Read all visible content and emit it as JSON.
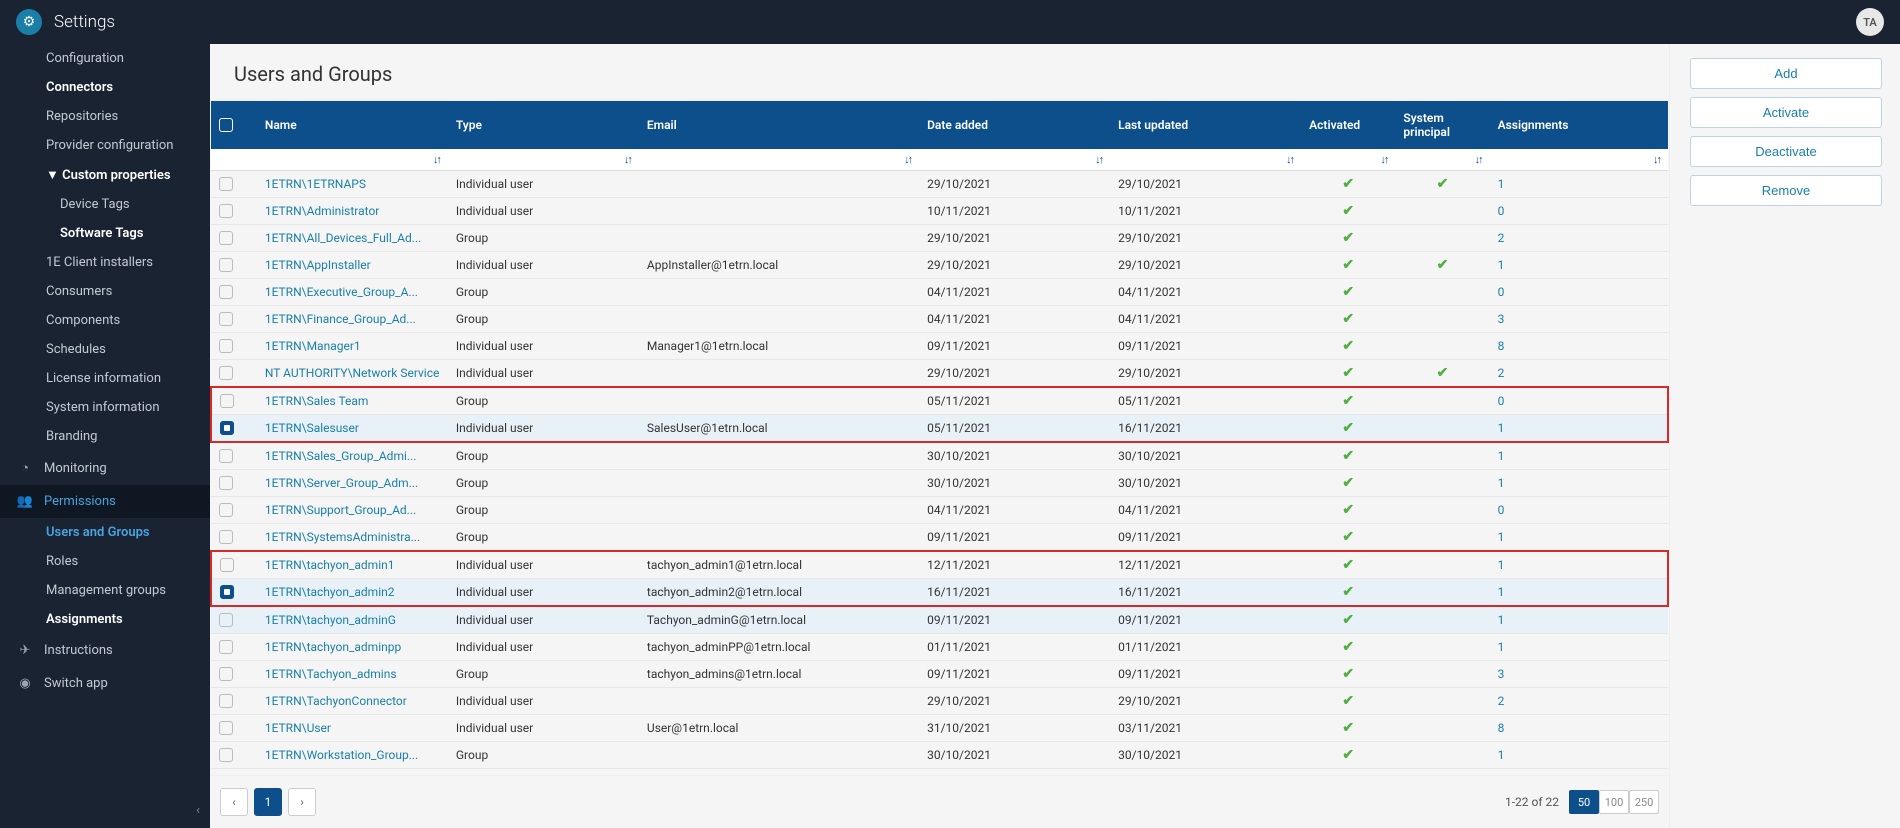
{
  "header": {
    "title": "Settings",
    "avatar": "TA"
  },
  "sidebar": {
    "top": [
      {
        "label": "Configuration",
        "kind": "dim"
      },
      {
        "label": "Connectors",
        "kind": "bold"
      },
      {
        "label": "Repositories",
        "kind": "item"
      },
      {
        "label": "Provider configuration",
        "kind": "item"
      },
      {
        "label": "Custom properties",
        "kind": "bold",
        "caret": true
      },
      {
        "label": "Device Tags",
        "kind": "l3dim"
      },
      {
        "label": "Software Tags",
        "kind": "l3"
      },
      {
        "label": "1E Client installers",
        "kind": "item"
      },
      {
        "label": "Consumers",
        "kind": "item"
      },
      {
        "label": "Components",
        "kind": "item"
      },
      {
        "label": "Schedules",
        "kind": "item"
      },
      {
        "label": "License information",
        "kind": "item"
      },
      {
        "label": "System information",
        "kind": "item"
      },
      {
        "label": "Branding",
        "kind": "item"
      }
    ],
    "sections": [
      {
        "icon": "◔",
        "label": "Monitoring",
        "active": false
      },
      {
        "icon": "👥",
        "label": "Permissions",
        "active": true
      }
    ],
    "perm_children": [
      {
        "label": "Users and Groups",
        "active": true
      },
      {
        "label": "Roles",
        "active": false
      },
      {
        "label": "Management groups",
        "active": false
      },
      {
        "label": "Assignments",
        "active": false,
        "bold": true
      }
    ],
    "bottom": [
      {
        "icon": "✈",
        "label": "Instructions"
      },
      {
        "icon": "◉",
        "label": "Switch app"
      }
    ]
  },
  "page": {
    "heading": "Users and Groups"
  },
  "columns": {
    "name": "Name",
    "type": "Type",
    "email": "Email",
    "date": "Date added",
    "updated": "Last updated",
    "activated": "Activated",
    "system": "System principal",
    "assignments": "Assignments"
  },
  "rows": [
    {
      "chk": false,
      "name": "1ETRN\\1ETRNAPS",
      "type": "Individual user",
      "email": "",
      "date": "29/10/2021",
      "upd": "29/10/2021",
      "act": true,
      "sys": true,
      "asn": "1",
      "hl": false,
      "box": ""
    },
    {
      "chk": false,
      "name": "1ETRN\\Administrator",
      "type": "Individual user",
      "email": "",
      "date": "10/11/2021",
      "upd": "10/11/2021",
      "act": true,
      "sys": false,
      "asn": "0",
      "hl": false,
      "box": ""
    },
    {
      "chk": false,
      "name": "1ETRN\\All_Devices_Full_Ad...",
      "type": "Group",
      "email": "",
      "date": "29/10/2021",
      "upd": "29/10/2021",
      "act": true,
      "sys": false,
      "asn": "2",
      "hl": false,
      "box": ""
    },
    {
      "chk": false,
      "name": "1ETRN\\AppInstaller",
      "type": "Individual user",
      "email": "AppInstaller@1etrn.local",
      "date": "29/10/2021",
      "upd": "29/10/2021",
      "act": true,
      "sys": true,
      "asn": "1",
      "hl": false,
      "box": ""
    },
    {
      "chk": false,
      "name": "1ETRN\\Executive_Group_A...",
      "type": "Group",
      "email": "",
      "date": "04/11/2021",
      "upd": "04/11/2021",
      "act": true,
      "sys": false,
      "asn": "0",
      "hl": false,
      "box": ""
    },
    {
      "chk": false,
      "name": "1ETRN\\Finance_Group_Ad...",
      "type": "Group",
      "email": "",
      "date": "04/11/2021",
      "upd": "04/11/2021",
      "act": true,
      "sys": false,
      "asn": "3",
      "hl": false,
      "box": ""
    },
    {
      "chk": false,
      "name": "1ETRN\\Manager1",
      "type": "Individual user",
      "email": "Manager1@1etrn.local",
      "date": "09/11/2021",
      "upd": "09/11/2021",
      "act": true,
      "sys": false,
      "asn": "8",
      "hl": false,
      "box": ""
    },
    {
      "chk": false,
      "name": "NT AUTHORITY\\Network Service",
      "type": "Individual user",
      "email": "",
      "date": "29/10/2021",
      "upd": "29/10/2021",
      "act": true,
      "sys": true,
      "asn": "2",
      "hl": false,
      "box": "",
      "wrap": true
    },
    {
      "chk": false,
      "name": "1ETRN\\Sales Team",
      "type": "Group",
      "email": "",
      "date": "05/11/2021",
      "upd": "05/11/2021",
      "act": true,
      "sys": false,
      "asn": "0",
      "hl": false,
      "box": "top"
    },
    {
      "chk": true,
      "name": "1ETRN\\Salesuser",
      "type": "Individual user",
      "email": "SalesUser@1etrn.local",
      "date": "05/11/2021",
      "upd": "16/11/2021",
      "act": true,
      "sys": false,
      "asn": "1",
      "hl": true,
      "box": "bottom"
    },
    {
      "chk": false,
      "name": "1ETRN\\Sales_Group_Admi...",
      "type": "Group",
      "email": "",
      "date": "30/10/2021",
      "upd": "30/10/2021",
      "act": true,
      "sys": false,
      "asn": "1",
      "hl": false,
      "box": ""
    },
    {
      "chk": false,
      "name": "1ETRN\\Server_Group_Adm...",
      "type": "Group",
      "email": "",
      "date": "30/10/2021",
      "upd": "30/10/2021",
      "act": true,
      "sys": false,
      "asn": "1",
      "hl": false,
      "box": ""
    },
    {
      "chk": false,
      "name": "1ETRN\\Support_Group_Ad...",
      "type": "Group",
      "email": "",
      "date": "04/11/2021",
      "upd": "04/11/2021",
      "act": true,
      "sys": false,
      "asn": "0",
      "hl": false,
      "box": ""
    },
    {
      "chk": false,
      "name": "1ETRN\\SystemsAdministra...",
      "type": "Group",
      "email": "",
      "date": "09/11/2021",
      "upd": "09/11/2021",
      "act": true,
      "sys": false,
      "asn": "1",
      "hl": false,
      "box": ""
    },
    {
      "chk": false,
      "name": "1ETRN\\tachyon_admin1",
      "type": "Individual user",
      "email": "tachyon_admin1@1etrn.local",
      "date": "12/11/2021",
      "upd": "12/11/2021",
      "act": true,
      "sys": false,
      "asn": "1",
      "hl": false,
      "box": "top"
    },
    {
      "chk": true,
      "name": "1ETRN\\tachyon_admin2",
      "type": "Individual user",
      "email": "tachyon_admin2@1etrn.local",
      "date": "16/11/2021",
      "upd": "16/11/2021",
      "act": true,
      "sys": false,
      "asn": "1",
      "hl": true,
      "box": "bottom"
    },
    {
      "chk": false,
      "name": "1ETRN\\tachyon_adminG",
      "type": "Individual user",
      "email": "Tachyon_adminG@1etrn.local",
      "date": "09/11/2021",
      "upd": "09/11/2021",
      "act": true,
      "sys": false,
      "asn": "1",
      "hl": true,
      "box": ""
    },
    {
      "chk": false,
      "name": "1ETRN\\tachyon_adminpp",
      "type": "Individual user",
      "email": "tachyon_adminPP@1etrn.local",
      "date": "01/11/2021",
      "upd": "01/11/2021",
      "act": true,
      "sys": false,
      "asn": "1",
      "hl": false,
      "box": ""
    },
    {
      "chk": false,
      "name": "1ETRN\\Tachyon_admins",
      "type": "Group",
      "email": "tachyon_admins@1etrn.local",
      "date": "09/11/2021",
      "upd": "09/11/2021",
      "act": true,
      "sys": false,
      "asn": "3",
      "hl": false,
      "box": ""
    },
    {
      "chk": false,
      "name": "1ETRN\\TachyonConnector",
      "type": "Individual user",
      "email": "",
      "date": "29/10/2021",
      "upd": "29/10/2021",
      "act": true,
      "sys": false,
      "asn": "2",
      "hl": false,
      "box": ""
    },
    {
      "chk": false,
      "name": "1ETRN\\User",
      "type": "Individual user",
      "email": "User@1etrn.local",
      "date": "31/10/2021",
      "upd": "03/11/2021",
      "act": true,
      "sys": false,
      "asn": "8",
      "hl": false,
      "box": ""
    },
    {
      "chk": false,
      "name": "1ETRN\\Workstation_Group...",
      "type": "Group",
      "email": "",
      "date": "30/10/2021",
      "upd": "30/10/2021",
      "act": true,
      "sys": false,
      "asn": "1",
      "hl": false,
      "box": ""
    }
  ],
  "paginator": {
    "page": "1",
    "range": "1-22 of 22",
    "sizes": [
      "50",
      "100",
      "250"
    ],
    "active_size": "50"
  },
  "actions": [
    "Add",
    "Activate",
    "Deactivate",
    "Remove"
  ]
}
